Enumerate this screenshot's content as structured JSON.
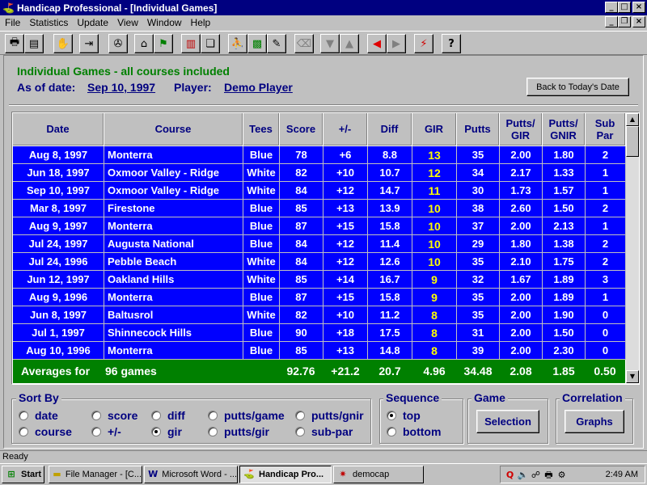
{
  "window": {
    "title": "Handicap Professional - [Individual Games]"
  },
  "menu": [
    "File",
    "Statistics",
    "Update",
    "View",
    "Window",
    "Help"
  ],
  "toolbar_icons": [
    "printer-icon",
    "report-icon",
    "stop-hand-icon",
    "exit-icon",
    "scan-icon",
    "clubhouse-icon",
    "flag-icon",
    "bar-chart-icon",
    "cards-icon",
    "golfer-icon",
    "course-map-icon",
    "edit-scorecard-icon",
    "eraser-icon",
    "move-down-icon",
    "move-up-icon",
    "back-arrow-icon",
    "forward-arrow-icon",
    "lightning-icon",
    "help-icon"
  ],
  "header": {
    "title": "Individual Games  -  all courses included",
    "as_of_label": "As of date:",
    "as_of_value": "Sep 10, 1997",
    "player_label": "Player:",
    "player_value": "Demo Player",
    "back_button": "Back to Today's Date"
  },
  "table": {
    "columns": [
      "Date",
      "Course",
      "Tees",
      "Score",
      "+/-",
      "Diff",
      "GIR",
      "Putts",
      "Putts/ GIR",
      "Putts/ GNIR",
      "Sub Par"
    ],
    "rows": [
      [
        "Aug 8, 1997",
        "Monterra",
        "Blue",
        "78",
        "+6",
        "8.8",
        "13",
        "35",
        "2.00",
        "1.80",
        "2"
      ],
      [
        "Jun 18, 1997",
        "Oxmoor Valley - Ridge",
        "White",
        "82",
        "+10",
        "10.7",
        "12",
        "34",
        "2.17",
        "1.33",
        "1"
      ],
      [
        "Sep 10, 1997",
        "Oxmoor Valley - Ridge",
        "White",
        "84",
        "+12",
        "14.7",
        "11",
        "30",
        "1.73",
        "1.57",
        "1"
      ],
      [
        "Mar 8, 1997",
        "Firestone",
        "Blue",
        "85",
        "+13",
        "13.9",
        "10",
        "38",
        "2.60",
        "1.50",
        "2"
      ],
      [
        "Aug 9, 1997",
        "Monterra",
        "Blue",
        "87",
        "+15",
        "15.8",
        "10",
        "37",
        "2.00",
        "2.13",
        "1"
      ],
      [
        "Jul 24, 1997",
        "Augusta National",
        "Blue",
        "84",
        "+12",
        "11.4",
        "10",
        "29",
        "1.80",
        "1.38",
        "2"
      ],
      [
        "Jul 24, 1996",
        "Pebble Beach",
        "White",
        "84",
        "+12",
        "12.6",
        "10",
        "35",
        "2.10",
        "1.75",
        "2"
      ],
      [
        "Jun 12, 1997",
        "Oakland Hills",
        "White",
        "85",
        "+14",
        "16.7",
        "9",
        "32",
        "1.67",
        "1.89",
        "3"
      ],
      [
        "Aug 9, 1996",
        "Monterra",
        "Blue",
        "87",
        "+15",
        "15.8",
        "9",
        "35",
        "2.00",
        "1.89",
        "1"
      ],
      [
        "Jun 8, 1997",
        "Baltusrol",
        "White",
        "82",
        "+10",
        "11.2",
        "8",
        "35",
        "2.00",
        "1.90",
        "0"
      ],
      [
        "Jul 1, 1997",
        "Shinnecock Hills",
        "Blue",
        "90",
        "+18",
        "17.5",
        "8",
        "31",
        "2.00",
        "1.50",
        "0"
      ],
      [
        "Aug 10, 1996",
        "Monterra",
        "Blue",
        "85",
        "+13",
        "14.8",
        "8",
        "39",
        "2.00",
        "2.30",
        "0"
      ]
    ],
    "averages": {
      "label": "Averages for",
      "games": "96 games",
      "score": "92.76",
      "plusminus": "+21.2",
      "diff": "20.7",
      "gir": "4.96",
      "putts": "34.48",
      "putts_gir": "2.08",
      "putts_gnir": "1.85",
      "sub_par": "0.50"
    }
  },
  "sort_by": {
    "label": "Sort By",
    "options": [
      "date",
      "course",
      "score",
      "+/-",
      "diff",
      "gir",
      "putts/game",
      "putts/gir",
      "putts/gnir",
      "sub-par"
    ],
    "selected": "gir"
  },
  "sequence": {
    "label": "Sequence",
    "options": [
      "top",
      "bottom"
    ],
    "selected": "top"
  },
  "game": {
    "label": "Game",
    "button": "Selection"
  },
  "correlation": {
    "label": "Correlation",
    "button": "Graphs"
  },
  "status": "Ready",
  "taskbar": {
    "start": "Start",
    "tasks": [
      "File Manager - [C...",
      "Microsoft Word - ...",
      "Handicap Pro...",
      "democap"
    ],
    "clock": "2:49 AM"
  }
}
